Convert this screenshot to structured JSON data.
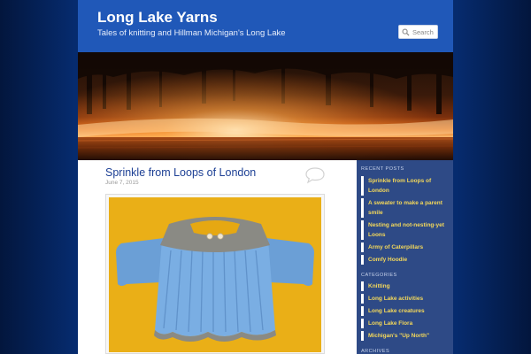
{
  "site": {
    "title": "Long Lake Yarns",
    "description": "Tales of knitting and Hillman Michigan's Long Lake"
  },
  "search": {
    "placeholder": "Search",
    "icon": "search-icon"
  },
  "post": {
    "title": "Sprinkle from Loops of London",
    "date": "June 7, 2015",
    "comment_icon": "comment-bubble-icon"
  },
  "sidebar": {
    "recent_posts": {
      "title": "RECENT POSTS",
      "items": [
        "Sprinkle from Loops of London",
        "A sweater to make a parent smile",
        "Nesting and not-nesting-yet Loons",
        "Army of Caterpillars",
        "Comfy Hoodie"
      ]
    },
    "categories": {
      "title": "CATEGORIES",
      "items": [
        "Knitting",
        "Long Lake activities",
        "Long Lake creatures",
        "Long Lake Flora",
        "Michigan's \"Up North\""
      ]
    },
    "archives": {
      "title": "ARCHIVES"
    }
  },
  "colors": {
    "page_background": "#062b6e",
    "header": "#2058b8",
    "sidebar": "#2e4a86",
    "link_yellow": "#f4d85a",
    "post_title": "#1c3f94"
  }
}
